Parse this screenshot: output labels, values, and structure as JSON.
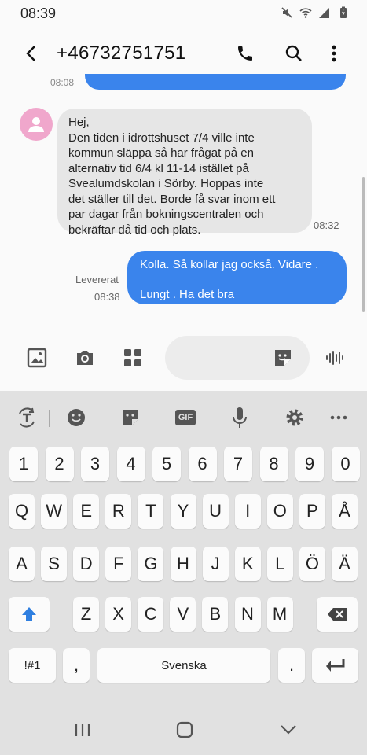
{
  "status_bar": {
    "time": "08:39"
  },
  "header": {
    "contact": "+46732751751"
  },
  "messages": {
    "previous_time": "08:08",
    "incoming": {
      "text": "Hej,\nDen tiden i idrottshuset 7/4 ville inte\nkommun släppa så har frågat på en\nalternativ tid 6/4 kl 11-14 istället på\nSvealumdskolan i Sörby. Hoppas inte\ndet ställer till det. Borde få svar inom ett\npar dagar från bokningscentralen och\nbekräftar då tid och plats.",
      "time": "08:32"
    },
    "outgoing": {
      "text": "Kolla. Så kollar jag också.  Vidare .\n\nLungt . Ha det bra",
      "status": "Levererat",
      "time": "08:38"
    }
  },
  "composer": {
    "placeholder": ""
  },
  "keyboard": {
    "number_row": [
      "1",
      "2",
      "3",
      "4",
      "5",
      "6",
      "7",
      "8",
      "9",
      "0"
    ],
    "row1": [
      "Q",
      "W",
      "E",
      "R",
      "T",
      "Y",
      "U",
      "I",
      "O",
      "P",
      "Å"
    ],
    "row2": [
      "A",
      "S",
      "D",
      "F",
      "G",
      "H",
      "J",
      "K",
      "L",
      "Ö",
      "Ä"
    ],
    "row3": [
      "Z",
      "X",
      "C",
      "V",
      "B",
      "N",
      "M"
    ],
    "symbols_key": "!#1",
    "comma_key": ",",
    "space_key": "Svenska",
    "period_key": ".",
    "gif_label": "GIF"
  },
  "colors": {
    "accent": "#3a84ec",
    "incoming_bubble": "#e6e6e6",
    "keyboard_bg": "#e1e1e1"
  }
}
